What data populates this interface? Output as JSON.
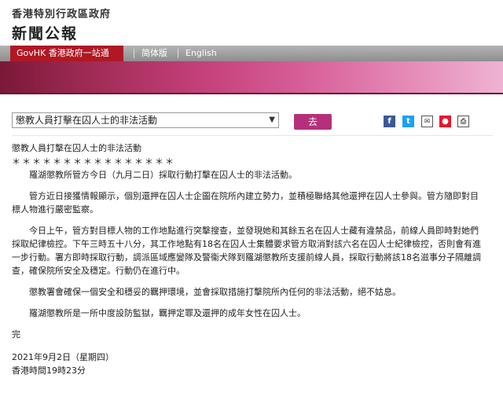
{
  "header": {
    "gov_name": "香港特別行政區政府",
    "section": "新聞公報"
  },
  "nav": {
    "govhk": "GovHK 香港政府一站通",
    "simplified": "简体版",
    "english": "English"
  },
  "toolbar": {
    "select_value": "懲教人員打擊在囚人士的非法活動",
    "go_label": "去",
    "share_icons": [
      "facebook-icon",
      "twitter-icon",
      "mail-icon",
      "weibo-icon",
      "print-icon"
    ]
  },
  "article": {
    "title": "懲教人員打擊在囚人士的非法活動",
    "stars": "＊＊＊＊＊＊＊＊＊＊＊＊＊＊＊＊",
    "paragraphs": [
      "羅湖懲教所管方今日（九月二日）採取行動打擊在囚人士的非法活動。",
      "管方近日接獲情報顯示，個別還押在囚人士企圖在院所內建立勢力，並積極聯絡其他還押在囚人士參與。管方隨即對目標人物進行嚴密監察。",
      "今日上午，管方對目標人物的工作地點進行突擊搜查，並發現她和其餘五名在囚人士藏有違禁品，前線人員即時對她們採取紀律檢控。下午三時五十八分，其工作地點有18名在囚人士集體要求管方取消對該六名在囚人士紀律檢控，否則會有進一步行動。署方即時採取行動，調派區域應變隊及警衞犬隊到羅湖懲教所支援前線人員，採取行動將該18名滋事分子隔離調查，確保院所安全及穩定。行動仍在進行中。",
      "懲教署會確保一個安全和穩妥的羈押環境，並會採取措施打擊院所內任何的非法活動，絕不姑息。",
      "羅湖懲教所是一所中度設防監獄，羈押定罪及還押的成年女性在囚人士。"
    ],
    "end": "完",
    "date": "2021年9月2日（星期四）",
    "time": "香港時間19時23分"
  },
  "colors": {
    "govhk_red": "#b01823",
    "banner_start": "#7b1838",
    "banner_end": "#efb3d2",
    "go_button": "#b5307a"
  }
}
